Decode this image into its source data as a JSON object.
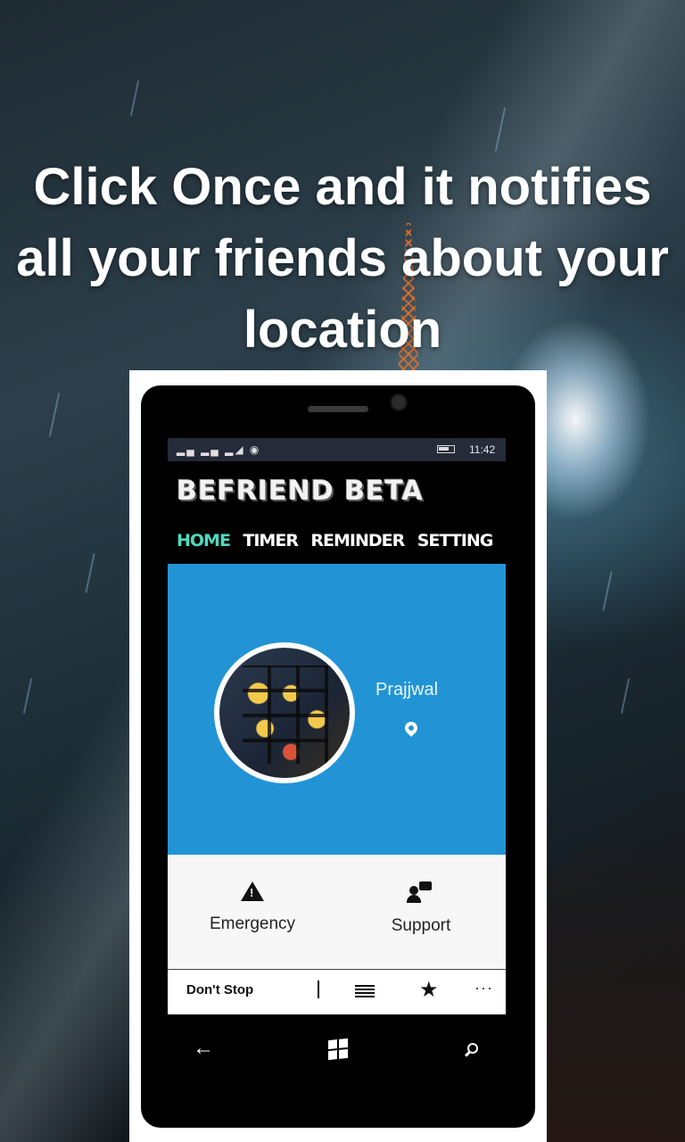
{
  "headline": {
    "line1": "Click Once and it notifies",
    "line2": "all your friends about your",
    "line3": "location"
  },
  "status_bar": {
    "signal_icons": "▂▄ ▂▄ ▂◢ ◉",
    "time": "11:42"
  },
  "app": {
    "title": "BEFRIEND BETA",
    "tabs": [
      {
        "label": "HOME",
        "active": true
      },
      {
        "label": "TIMER",
        "active": false
      },
      {
        "label": "REMINDER",
        "active": false
      },
      {
        "label": "SETTING",
        "active": false
      }
    ],
    "profile": {
      "name": "Prajjwal",
      "location_icon": "map-pin-icon",
      "background_color": "#2294d6"
    },
    "actions": [
      {
        "label": "Emergency",
        "icon": "warning-icon"
      },
      {
        "label": "Support",
        "icon": "person-chat-icon"
      }
    ],
    "app_bar": {
      "label": "Don't Stop",
      "separator": "|",
      "icons": [
        "list-icon",
        "star-icon",
        "more-icon"
      ],
      "more_glyph": "···"
    }
  },
  "nav_bar": {
    "back_glyph": "←",
    "icons": [
      "back-icon",
      "windows-icon",
      "search-icon"
    ]
  },
  "colors": {
    "accent_tab": "#4ed9c0",
    "profile_bg": "#2294d6"
  }
}
